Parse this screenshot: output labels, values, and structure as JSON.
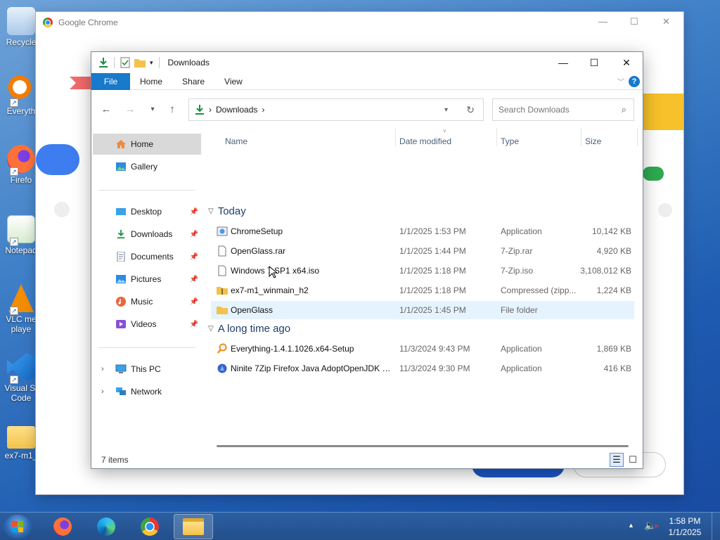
{
  "desktop": {
    "icons": [
      {
        "label": "Recycle",
        "glyph": "recycle-bin-icon"
      },
      {
        "label": "Everyth",
        "glyph": "everything-icon"
      },
      {
        "label": "Firefo",
        "glyph": "firefox-icon"
      },
      {
        "label": "Notepad",
        "glyph": "notepad-icon"
      },
      {
        "label": "VLC me",
        "label2": "playe",
        "glyph": "vlc-icon"
      },
      {
        "label": "Visual St",
        "label2": "Code",
        "glyph": "vscode-icon"
      },
      {
        "label": "ex7-m1_",
        "glyph": "folder-icon"
      }
    ]
  },
  "chrome": {
    "title": "Google Chrome"
  },
  "explorer": {
    "title": "Downloads",
    "ribbon": {
      "tabs": [
        "File",
        "Home",
        "Share",
        "View"
      ],
      "help": "?"
    },
    "nav": {
      "path": [
        "Downloads"
      ],
      "search_placeholder": "Search Downloads"
    },
    "sidebar": {
      "items": [
        {
          "label": "Home",
          "icon": "home-icon",
          "selected": true
        },
        {
          "label": "Gallery",
          "icon": "gallery-icon"
        },
        {
          "label": "Desktop",
          "icon": "desktop-icon",
          "pinned": true
        },
        {
          "label": "Downloads",
          "icon": "downloads-icon",
          "pinned": true
        },
        {
          "label": "Documents",
          "icon": "documents-icon",
          "pinned": true
        },
        {
          "label": "Pictures",
          "icon": "pictures-icon",
          "pinned": true
        },
        {
          "label": "Music",
          "icon": "music-icon",
          "pinned": true
        },
        {
          "label": "Videos",
          "icon": "videos-icon",
          "pinned": true
        },
        {
          "label": "This PC",
          "icon": "this-pc-icon"
        },
        {
          "label": "Network",
          "icon": "network-icon"
        }
      ]
    },
    "columns": [
      "Name",
      "Date modified",
      "Type",
      "Size"
    ],
    "groups": [
      {
        "label": "Today",
        "files": [
          {
            "name": "ChromeSetup",
            "date": "1/1/2025 1:53 PM",
            "type": "Application",
            "size": "10,142 KB",
            "icon": "installer-icon"
          },
          {
            "name": "OpenGlass.rar",
            "date": "1/1/2025 1:44 PM",
            "type": "7-Zip.rar",
            "size": "4,920 KB",
            "icon": "file-icon"
          },
          {
            "name": "Windows 7 SP1 x64.iso",
            "date": "1/1/2025 1:18 PM",
            "type": "7-Zip.iso",
            "size": "3,108,012 KB",
            "icon": "file-icon"
          },
          {
            "name": "ex7-m1_winmain_h2",
            "date": "1/1/2025 1:18 PM",
            "type": "Compressed (zipp...",
            "size": "1,224 KB",
            "icon": "zip-folder-icon"
          },
          {
            "name": "OpenGlass",
            "date": "1/1/2025 1:45 PM",
            "type": "File folder",
            "size": "",
            "icon": "folder-icon"
          }
        ]
      },
      {
        "label": "A long time ago",
        "files": [
          {
            "name": "Everything-1.4.1.1026.x64-Setup",
            "date": "11/3/2024 9:43 PM",
            "type": "Application",
            "size": "1,869 KB",
            "icon": "everything-icon"
          },
          {
            "name": "Ninite 7Zip Firefox Java AdoptOpenJDK x...",
            "date": "11/3/2024 9:30 PM",
            "type": "Application",
            "size": "416 KB",
            "icon": "ninite-icon"
          }
        ]
      }
    ],
    "status": "7 items"
  },
  "taskbar": {
    "apps": [
      "firefox-icon",
      "edge-icon",
      "chrome-icon",
      "file-explorer-icon"
    ],
    "active_app": "file-explorer-icon",
    "time": "1:58 PM",
    "date": "1/1/2025"
  },
  "colors": {
    "accent": "#1979ca",
    "selection": "#e5f3ff",
    "sidebar_selected": "#d9d9d9"
  }
}
